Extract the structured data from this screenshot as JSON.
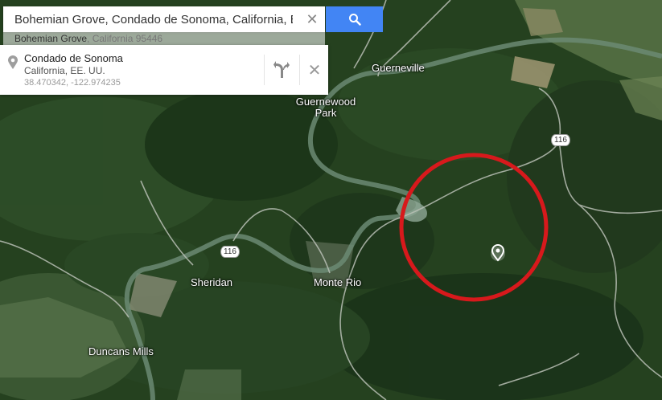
{
  "search": {
    "query": "Bohemian Grove, Condado de Sonoma, California, Esta",
    "clear_icon": "close-icon",
    "button_icon": "search-icon",
    "button_color": "#4285f4"
  },
  "suggestion": {
    "main": "Bohemian Grove",
    "secondary": ", California 95446"
  },
  "place_card": {
    "name": "Condado de Sonoma",
    "region": "California, EE. UU.",
    "coordinates": "38.470342, -122.974235",
    "directions_icon": "directions-icon",
    "close_icon": "close-icon"
  },
  "map": {
    "type": "satellite",
    "towns": [
      "Guerneville",
      "Guernewood Park",
      "Sheridan",
      "Monte Rio",
      "Duncans Mills"
    ],
    "route_shields": [
      "116",
      "116"
    ],
    "highlight_circle_color": "#d7191c",
    "marker_icon": "location-pin-icon"
  }
}
